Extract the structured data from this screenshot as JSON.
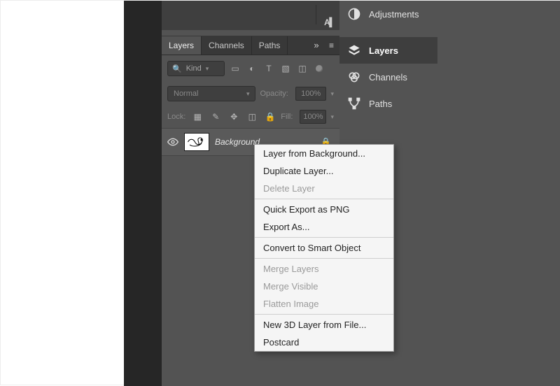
{
  "top_strip": {
    "type_glyph": "A▍"
  },
  "panel": {
    "tabs": [
      {
        "label": "Layers",
        "active": true
      },
      {
        "label": "Channels",
        "active": false
      },
      {
        "label": "Paths",
        "active": false
      }
    ],
    "kind_label": "Kind",
    "blend_mode": "Normal",
    "opacity_label": "Opacity:",
    "opacity_value": "100%",
    "lock_label": "Lock:",
    "fill_label": "Fill:",
    "fill_value": "100%",
    "layer": {
      "name": "Background"
    }
  },
  "right_palette": {
    "items": [
      {
        "name": "Adjustments"
      },
      {
        "name": "Layers",
        "active": true
      },
      {
        "name": "Channels"
      },
      {
        "name": "Paths"
      }
    ]
  },
  "context_menu": {
    "groups": [
      [
        {
          "label": "Layer from Background...",
          "disabled": false
        },
        {
          "label": "Duplicate Layer...",
          "disabled": false
        },
        {
          "label": "Delete Layer",
          "disabled": true
        }
      ],
      [
        {
          "label": "Quick Export as PNG",
          "disabled": false
        },
        {
          "label": "Export As...",
          "disabled": false
        }
      ],
      [
        {
          "label": "Convert to Smart Object",
          "disabled": false
        }
      ],
      [
        {
          "label": "Merge Layers",
          "disabled": true
        },
        {
          "label": "Merge Visible",
          "disabled": true
        },
        {
          "label": "Flatten Image",
          "disabled": true
        }
      ],
      [
        {
          "label": "New 3D Layer from File...",
          "disabled": false
        },
        {
          "label": "Postcard",
          "disabled": false
        }
      ]
    ]
  }
}
